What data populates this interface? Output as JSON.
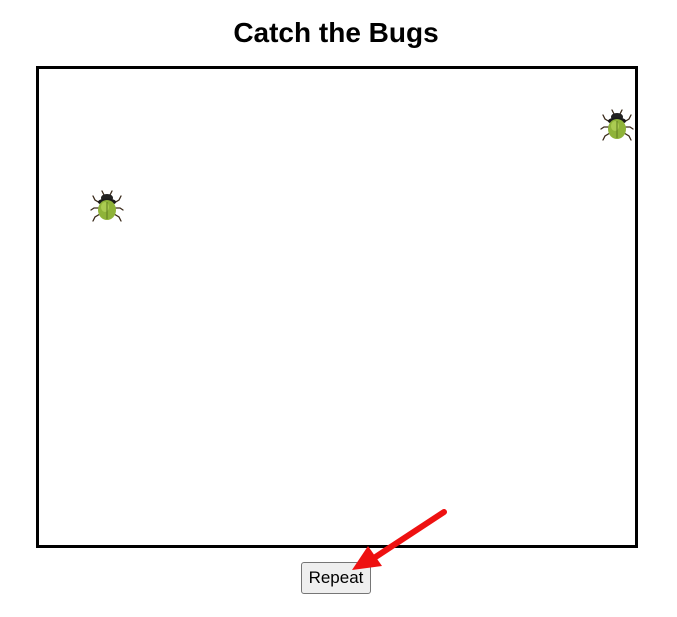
{
  "page": {
    "title": "Catch the Bugs"
  },
  "game": {
    "bugs": [
      {
        "icon": "beetle-icon"
      },
      {
        "icon": "beetle-icon"
      }
    ]
  },
  "controls": {
    "repeat_label": "Repeat"
  },
  "colors": {
    "annotation_arrow": "#ee1111",
    "border": "#000000",
    "bug_body": "#8fb339"
  }
}
